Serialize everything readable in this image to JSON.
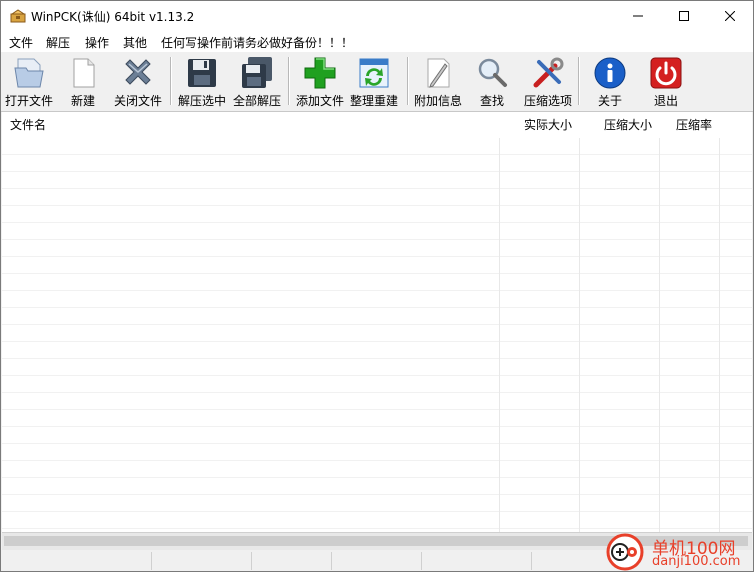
{
  "window": {
    "title": "WinPCK(诛仙) 64bit v1.13.2"
  },
  "menu": [
    "文件",
    "解压",
    "操作",
    "其他",
    "任何写操作前请务必做好备份！！！"
  ],
  "toolbar": [
    {
      "label": "打开文件",
      "icon": "open-file-icon"
    },
    {
      "label": "新建",
      "icon": "new-file-icon"
    },
    {
      "label": "关闭文件",
      "icon": "close-file-icon"
    },
    {
      "label": "解压选中",
      "icon": "extract-selected-icon"
    },
    {
      "label": "全部解压",
      "icon": "extract-all-icon"
    },
    {
      "label": "添加文件",
      "icon": "add-file-icon"
    },
    {
      "label": "整理重建",
      "icon": "rebuild-icon"
    },
    {
      "label": "附加信息",
      "icon": "extra-info-icon"
    },
    {
      "label": "查找",
      "icon": "search-icon"
    },
    {
      "label": "压缩选项",
      "icon": "compress-options-icon"
    },
    {
      "label": "关于",
      "icon": "about-icon"
    },
    {
      "label": "退出",
      "icon": "exit-icon"
    }
  ],
  "columns": [
    "文件名",
    "实际大小",
    "压缩大小",
    "压缩率"
  ],
  "watermark": {
    "text": "单机100网",
    "url": "danji100.com"
  },
  "colors": {
    "accent_green": "#1fa01f",
    "exit_red": "#d42020",
    "info_blue": "#1a5fc8",
    "watermark": "#e8402a"
  }
}
